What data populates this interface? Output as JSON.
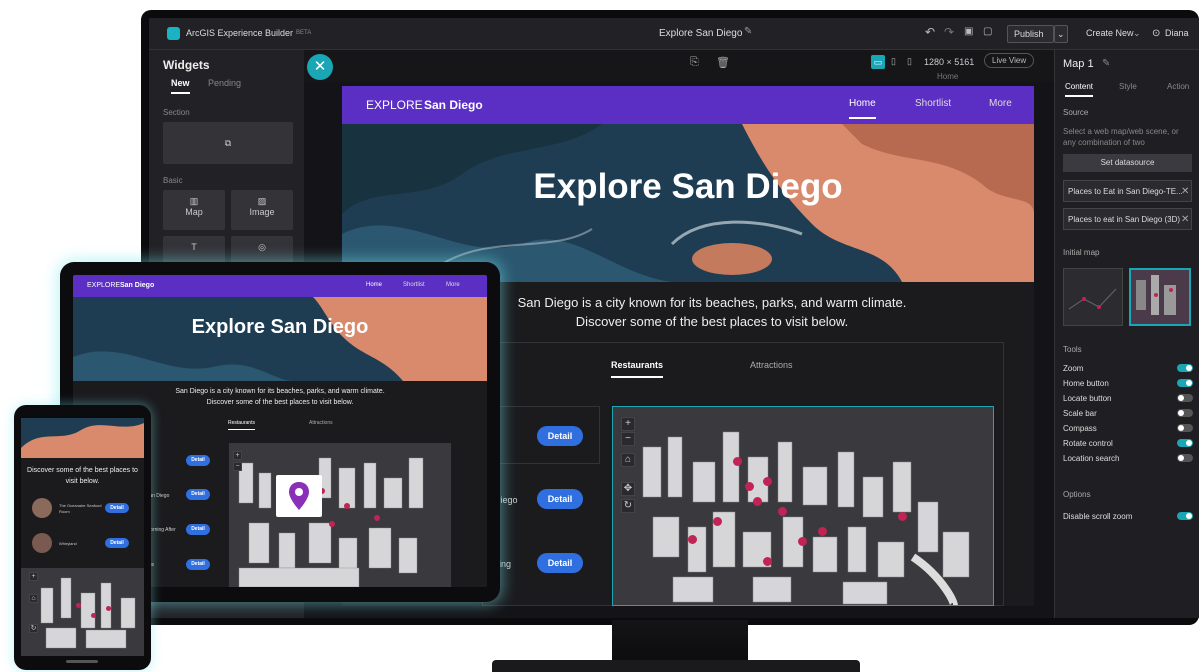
{
  "topbar": {
    "app_title": "ArcGIS Experience Builder",
    "app_badge": "BETA",
    "doc_title": "Explore San Diego",
    "publish_label": "Publish",
    "create_new_label": "Create New",
    "user_label": "Diana"
  },
  "left_panel": {
    "title": "Widgets",
    "tabs": [
      "New",
      "Pending"
    ],
    "section_label": "Section",
    "basic_label": "Basic",
    "widgets": [
      "Map",
      "Image"
    ]
  },
  "canvas": {
    "size_label": "1280 × 5161",
    "live_view_label": "Live View",
    "page_label": "Home"
  },
  "site": {
    "brand_prefix": "EXPLORE",
    "brand_name": "San Diego",
    "nav": [
      "Home",
      "Shortlist",
      "More"
    ],
    "hero_title": "Explore San Diego",
    "intro_line1": "San Diego is a city known for its beaches, parks, and warm climate.",
    "intro_line2": "Discover some of the best places to visit below.",
    "tabs": [
      "Restaurants",
      "Attractions"
    ],
    "detail_label": "Detail",
    "list_fragments": [
      "Diego",
      "ning"
    ]
  },
  "right_panel": {
    "widget_name": "Map 1",
    "tabs": [
      "Content",
      "Style",
      "Action"
    ],
    "source_label": "Source",
    "source_desc": "Select a web map/web scene, or any combination of two",
    "set_datasource_label": "Set datasource",
    "datasources": [
      "Places to Eat in San Diego-TE...",
      "Places to eat in San Diego (3D)"
    ],
    "initial_map_label": "Initial map",
    "tools_label": "Tools",
    "tools": [
      {
        "label": "Zoom",
        "on": true
      },
      {
        "label": "Home button",
        "on": true
      },
      {
        "label": "Locate button",
        "on": false
      },
      {
        "label": "Scale bar",
        "on": false
      },
      {
        "label": "Compass",
        "on": false
      },
      {
        "label": "Rotate control",
        "on": true
      },
      {
        "label": "Location search",
        "on": false
      }
    ],
    "options_label": "Options",
    "options": [
      {
        "label": "Disable scroll zoom",
        "on": true
      }
    ]
  },
  "laptop": {
    "list_items": [
      "t",
      "San Diego",
      "Morning After",
      "ups"
    ]
  },
  "phone": {
    "intro": "Discover some of the best places to visit below.",
    "list_items": [
      "The Oceanaire Seafood Room",
      "Whiryland"
    ]
  },
  "colors": {
    "accent": "#5b2fc4",
    "detail": "#2f6fe0",
    "pin": "#c02454",
    "toggle_on": "#1aa6b5"
  }
}
